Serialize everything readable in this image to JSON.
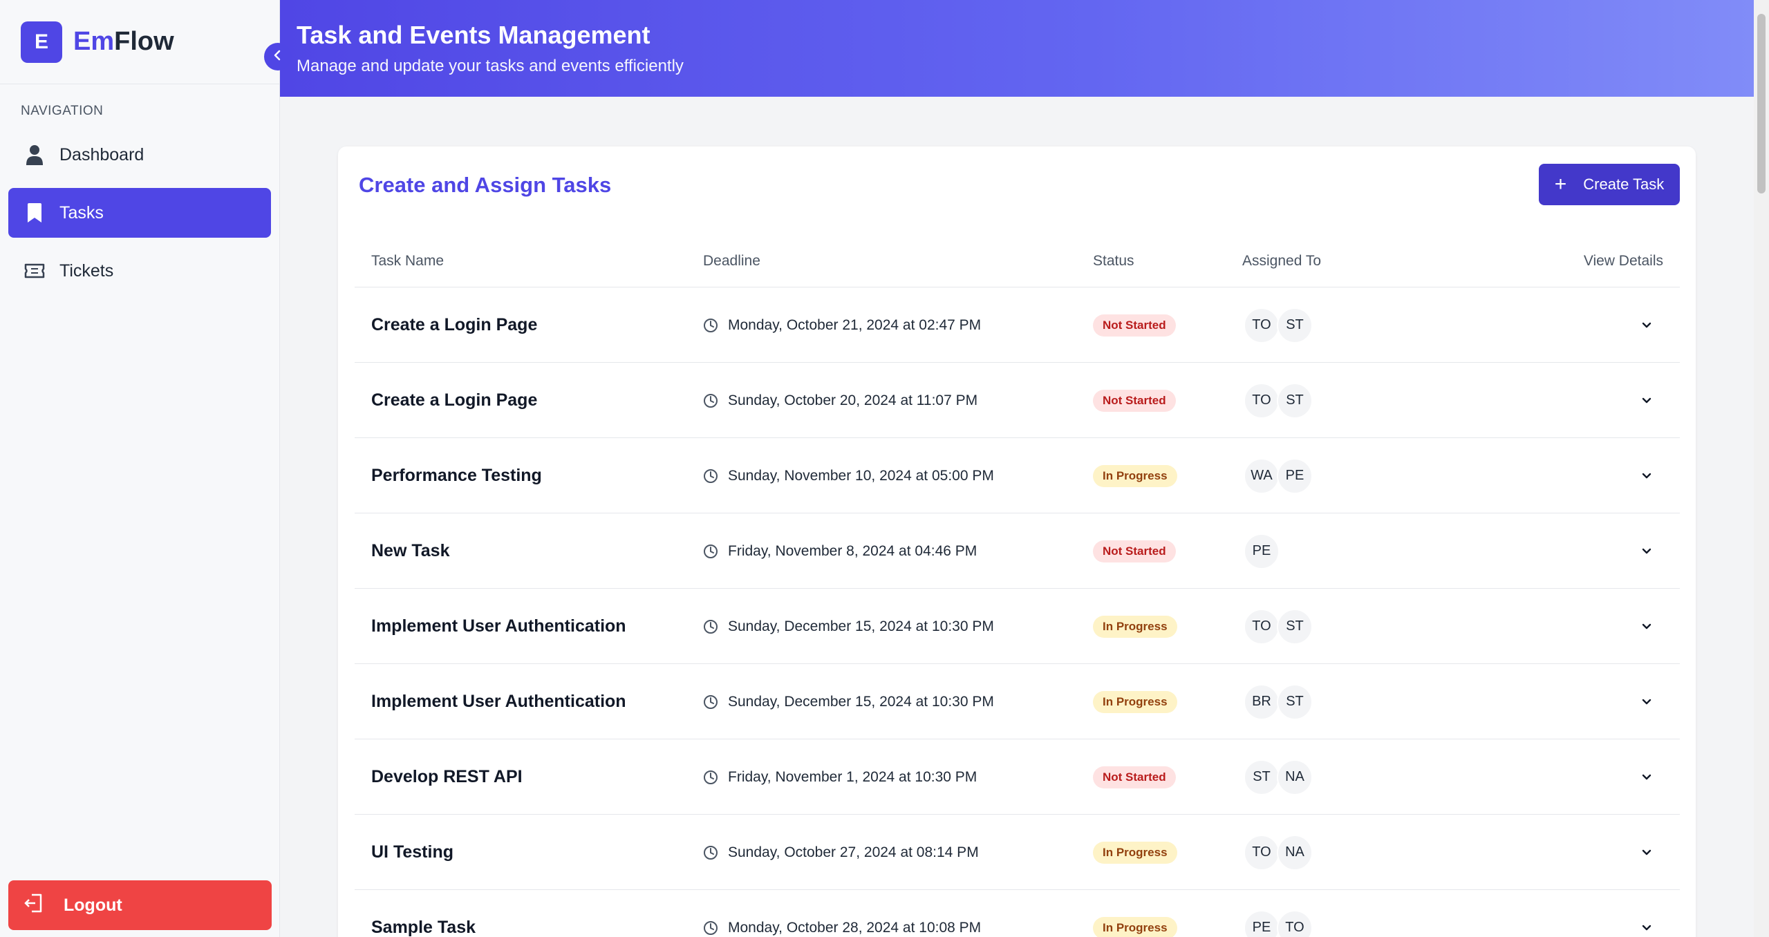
{
  "brand": {
    "logo_letter": "E",
    "name_prefix": "Em",
    "name_suffix": "Flow"
  },
  "sidebar": {
    "heading": "NAVIGATION",
    "items": [
      {
        "label": "Dashboard",
        "icon": "user-icon"
      },
      {
        "label": "Tasks",
        "icon": "bookmark-icon",
        "active": true
      },
      {
        "label": "Tickets",
        "icon": "ticket-icon"
      }
    ],
    "logout_label": "Logout"
  },
  "header": {
    "title": "Task and Events Management",
    "subtitle": "Manage and update your tasks and events efficiently"
  },
  "card": {
    "title": "Create and Assign Tasks",
    "create_button": "Create Task"
  },
  "table": {
    "columns": [
      "Task Name",
      "Deadline",
      "Status",
      "Assigned To",
      "View Details"
    ],
    "rows": [
      {
        "name": "Create a Login Page",
        "deadline": "Monday, October 21, 2024 at 02:47 PM",
        "status": "Not Started",
        "assignees": [
          "TO",
          "ST"
        ]
      },
      {
        "name": "Create a Login Page",
        "deadline": "Sunday, October 20, 2024 at 11:07 PM",
        "status": "Not Started",
        "assignees": [
          "TO",
          "ST"
        ]
      },
      {
        "name": "Performance Testing",
        "deadline": "Sunday, November 10, 2024 at 05:00 PM",
        "status": "In Progress",
        "assignees": [
          "WA",
          "PE"
        ]
      },
      {
        "name": "New Task",
        "deadline": "Friday, November 8, 2024 at 04:46 PM",
        "status": "Not Started",
        "assignees": [
          "PE"
        ]
      },
      {
        "name": "Implement User Authentication",
        "deadline": "Sunday, December 15, 2024 at 10:30 PM",
        "status": "In Progress",
        "assignees": [
          "TO",
          "ST"
        ]
      },
      {
        "name": "Implement User Authentication",
        "deadline": "Sunday, December 15, 2024 at 10:30 PM",
        "status": "In Progress",
        "assignees": [
          "BR",
          "ST"
        ]
      },
      {
        "name": "Develop REST API",
        "deadline": "Friday, November 1, 2024 at 10:30 PM",
        "status": "Not Started",
        "assignees": [
          "ST",
          "NA"
        ]
      },
      {
        "name": "UI Testing",
        "deadline": "Sunday, October 27, 2024 at 08:14 PM",
        "status": "In Progress",
        "assignees": [
          "TO",
          "NA"
        ]
      },
      {
        "name": "Sample Task",
        "deadline": "Monday, October 28, 2024 at 10:08 PM",
        "status": "In Progress",
        "assignees": [
          "PE",
          "TO"
        ]
      }
    ]
  },
  "colors": {
    "accent": "#4f46e5",
    "logout": "#ef4444",
    "not_started_bg": "#fee2e2",
    "not_started_text": "#b91c1c",
    "in_progress_bg": "#fef3c7",
    "in_progress_text": "#92400e"
  }
}
